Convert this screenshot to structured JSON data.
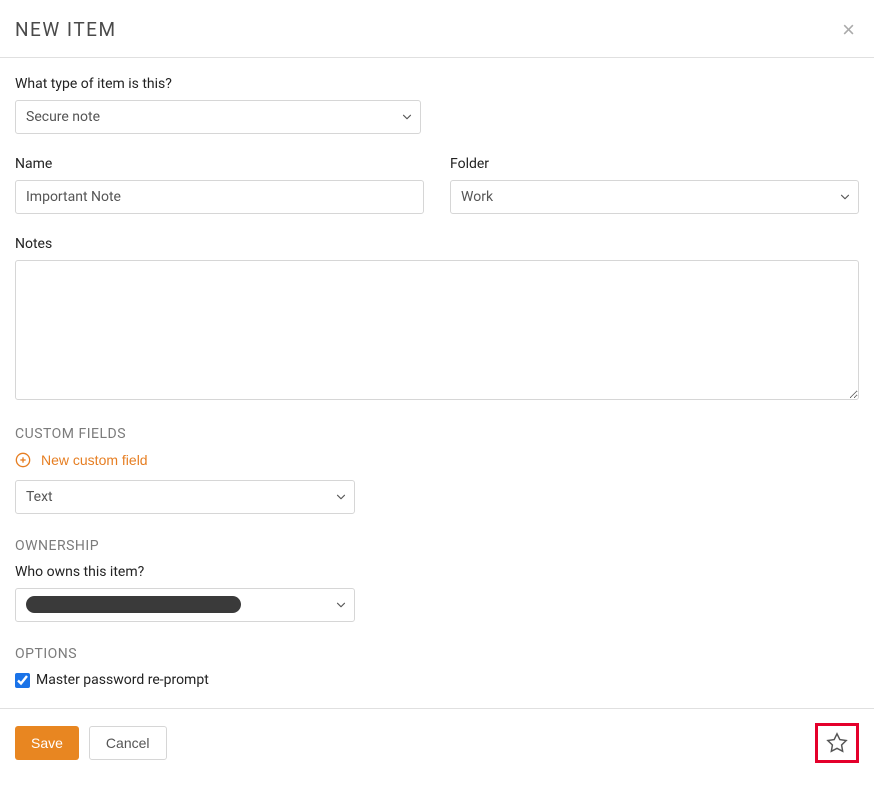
{
  "modal": {
    "title": "NEW ITEM"
  },
  "form": {
    "type_label": "What type of item is this?",
    "type_value": "Secure note",
    "name_label": "Name",
    "name_value": "Important Note",
    "folder_label": "Folder",
    "folder_value": "Work",
    "notes_label": "Notes",
    "notes_value": ""
  },
  "custom_fields": {
    "heading": "CUSTOM FIELDS",
    "new_label": "New custom field",
    "field_type_value": "Text"
  },
  "ownership": {
    "heading": "OWNERSHIP",
    "owner_label": "Who owns this item?",
    "owner_value": ""
  },
  "options": {
    "heading": "OPTIONS",
    "master_reprompt_label": "Master password re-prompt",
    "master_reprompt_checked": true
  },
  "footer": {
    "save_label": "Save",
    "cancel_label": "Cancel"
  }
}
